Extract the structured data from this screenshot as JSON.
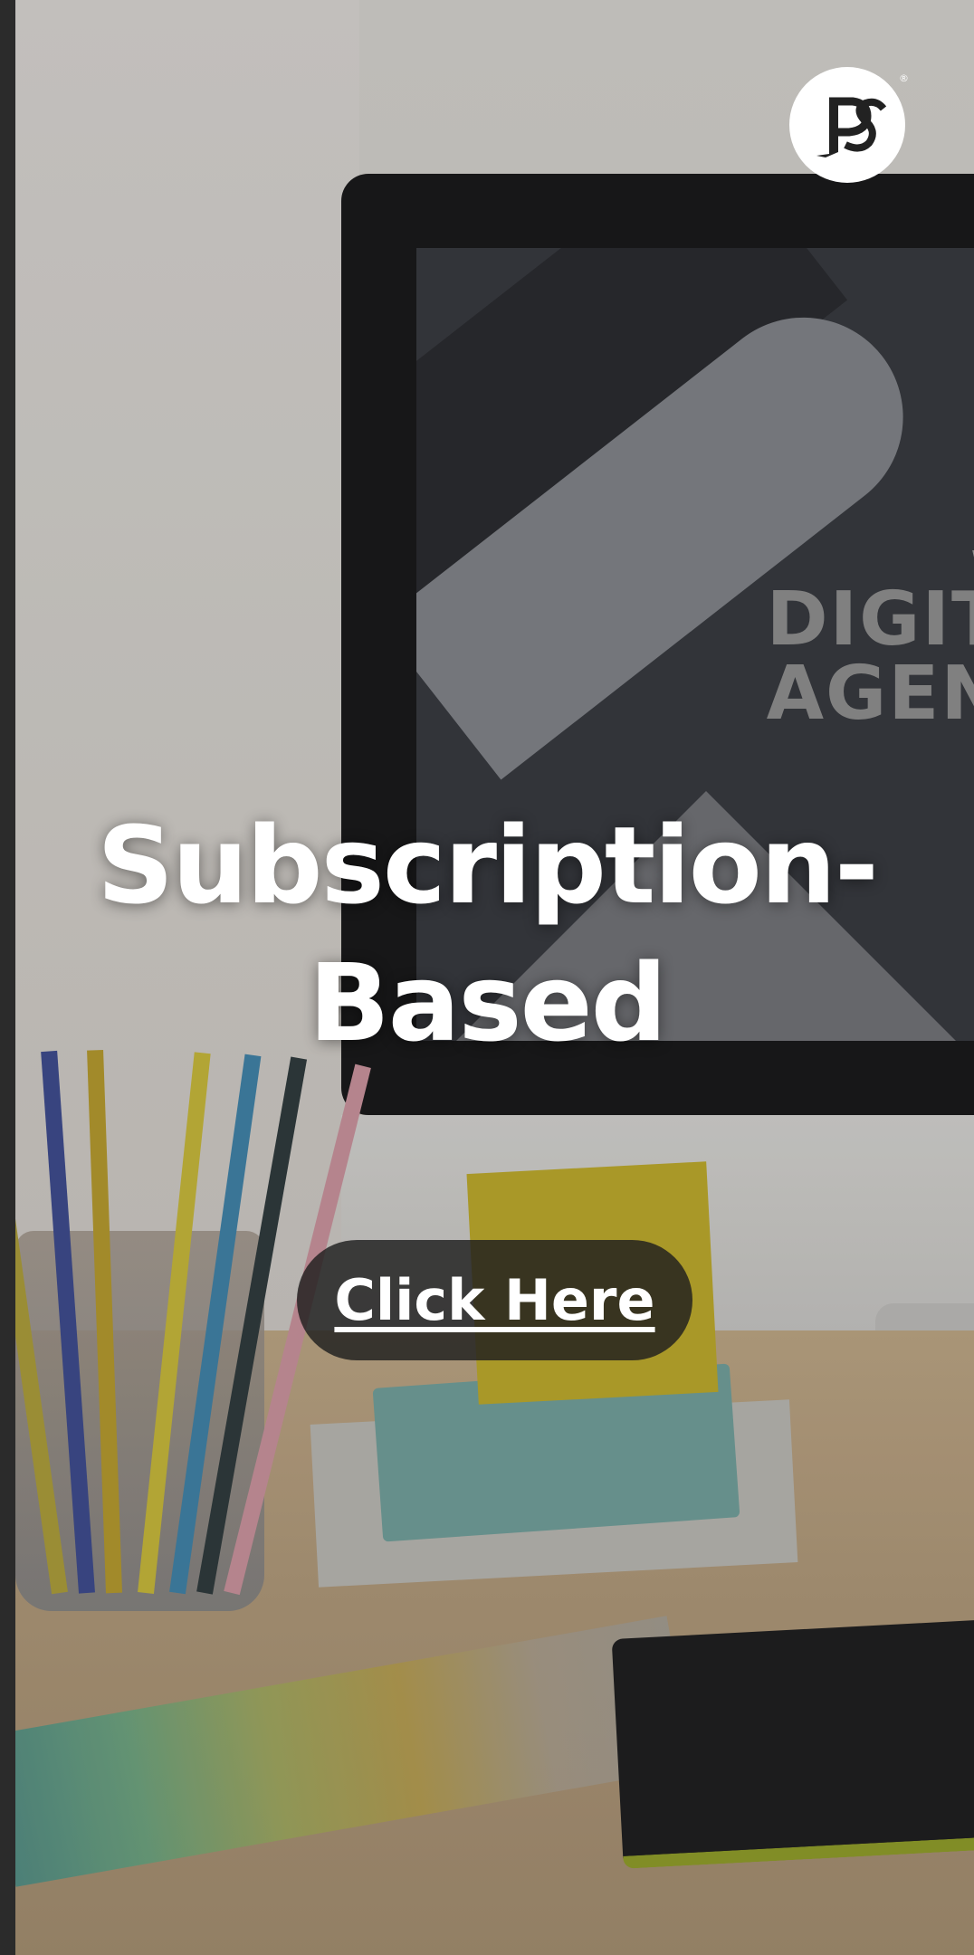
{
  "logo": {
    "text": "PS",
    "registered": "®"
  },
  "background": {
    "screen_text_line1": "W",
    "screen_text_line2": "DIGIT",
    "screen_text_line3": "AGEN"
  },
  "hero": {
    "headline_line1": "Subscription-",
    "headline_line2": "Based",
    "cta_label": "Click Here"
  },
  "colors": {
    "text": "#ffffff",
    "cta_background": "#1e1e1e",
    "logo_background": "#ffffff"
  }
}
